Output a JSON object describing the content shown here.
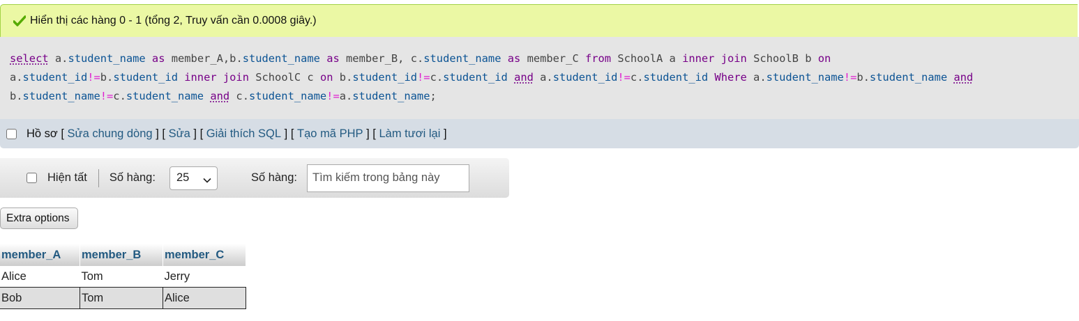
{
  "success": {
    "message": "Hiển thị các hàng 0 - 1 (tổng 2, Truy vấn cần 0.0008 giây.)",
    "icon": "check-icon",
    "color": "#55aa00"
  },
  "sql": {
    "select": "select",
    "as": "as",
    "from": "from",
    "inner": "inner",
    "join": "join",
    "on": "on",
    "and": "and",
    "where": "Where",
    "a": "a",
    "b": "b",
    "c": "c",
    "a_dot": "a.",
    "b_dot": "b.",
    "c_dot": "c.",
    "comma": ",",
    "comma_space": ", ",
    "neq": "!=",
    "semicolon": ";",
    "student_name": "student_name",
    "student_id": "student_id",
    "member_a": "member_A",
    "member_b": "member_B",
    "member_c": "member_C",
    "school_a": "SchoolA",
    "school_b": "SchoolB",
    "school_c": "SchoolC"
  },
  "toolbar": {
    "profile_label": "Hồ sơ",
    "open_bracket": "[",
    "close_bracket": "]",
    "links": [
      "Sửa chung dòng",
      "Sửa",
      "Giải thích SQL",
      "Tạo mã PHP",
      "Làm tươi lại"
    ]
  },
  "nav": {
    "show_all_label": "Hiện tất",
    "rows_label": "Số hàng:",
    "rows_value": "25",
    "filter_label": "Số hàng:",
    "search_placeholder": "Tìm kiếm trong bảng này"
  },
  "extra_options_label": "Extra options",
  "table": {
    "columns": [
      "member_A",
      "member_B",
      "member_C"
    ],
    "rows": [
      [
        "Alice",
        "Tom",
        "Jerry"
      ],
      [
        "Bob",
        "Tom",
        "Alice"
      ]
    ]
  }
}
